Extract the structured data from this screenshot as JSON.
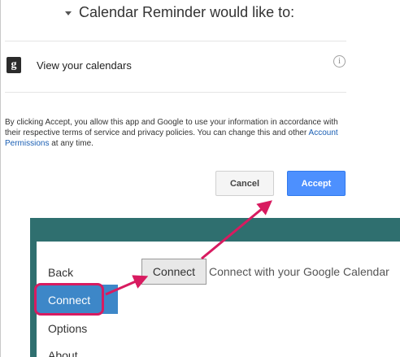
{
  "consent_dialog": {
    "header_text": "Calendar Reminder would like to:",
    "permission": {
      "icon_letter": "g",
      "label": "View your calendars",
      "info_icon_glyph": "i"
    },
    "disclaimer_before_link": "By clicking Accept, you allow this app and Google to use your information in accordance with their respective terms of service and privacy policies. You can change this and other ",
    "disclaimer_link": "Account Permissions",
    "disclaimer_after_link": " at any time.",
    "cancel_label": "Cancel",
    "accept_label": "Accept"
  },
  "app": {
    "nav_items": [
      "Back",
      "Connect",
      "Options",
      "About"
    ],
    "active_nav": "Connect",
    "connect_button_label": "Connect",
    "connect_description": "Connect with your Google Calendar"
  },
  "colors": {
    "accept_blue": "#4d90fe",
    "annotation_pink": "#d81b60",
    "app_header_teal": "#2f6f6f",
    "nav_active_blue": "#3d87c8"
  }
}
